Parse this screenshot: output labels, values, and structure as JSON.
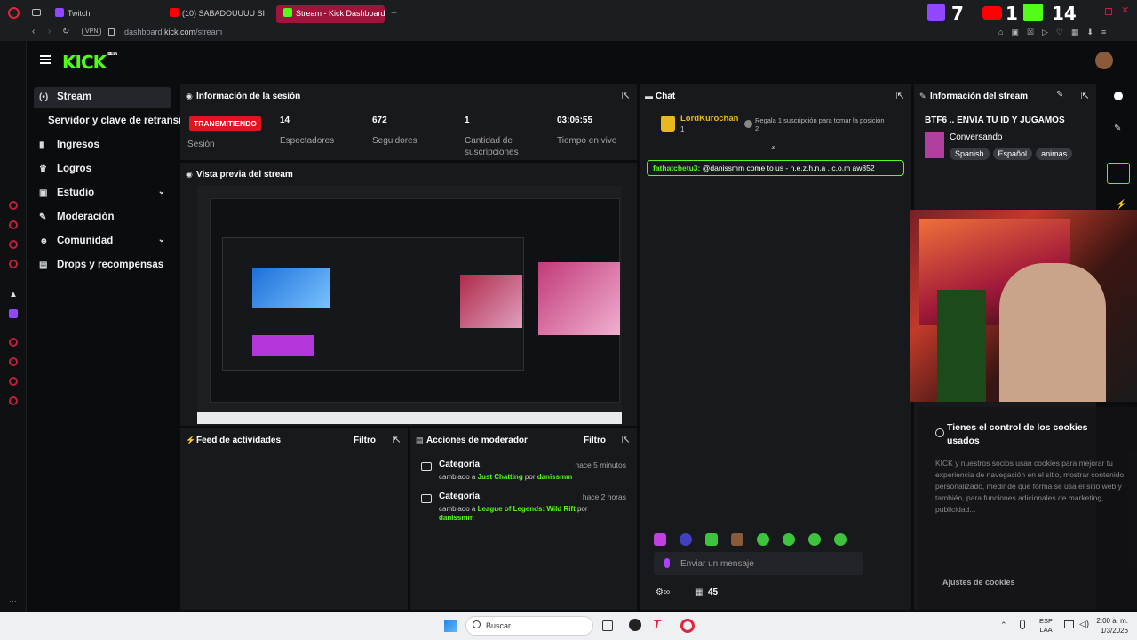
{
  "browser": {
    "tabs": [
      {
        "label": "Twitch",
        "color": "#9146ff"
      },
      {
        "label": "(10) SABADOUUUU SI",
        "color": "#ff0000"
      },
      {
        "label": "Stream - Kick Dashboard",
        "color": "#53fc18"
      }
    ],
    "vpn": "VPN",
    "url_host": "dashboard.",
    "url_domain": "kick.com",
    "url_path": "/stream",
    "overlay": {
      "twitch": "7",
      "youtube": "1",
      "kick": "14"
    }
  },
  "kick": {
    "logo": "KICK",
    "beta": "BETA",
    "nav": [
      {
        "label": "Stream",
        "icon": "radio-icon"
      },
      {
        "label": "Servidor y clave de retransmisión"
      },
      {
        "label": "Ingresos",
        "icon": "chart-icon"
      },
      {
        "label": "Logros",
        "icon": "trophy-icon"
      },
      {
        "label": "Estudio",
        "icon": "studio-icon"
      },
      {
        "label": "Moderación",
        "icon": "wrench-icon"
      },
      {
        "label": "Comunidad",
        "icon": "people-icon"
      },
      {
        "label": "Drops y recompensas",
        "icon": "gift-icon"
      }
    ]
  },
  "session": {
    "title": "Información de la sesión",
    "status": "TRANSMITIENDO",
    "status_label": "Sesión",
    "stats": [
      {
        "value": "14",
        "label": "Espectadores"
      },
      {
        "value": "672",
        "label": "Seguidores"
      },
      {
        "value": "1",
        "label": "Cantidad de suscripciones"
      },
      {
        "value": "03:06:55",
        "label": "Tiempo en vivo"
      }
    ]
  },
  "preview": {
    "title": "Vista previa del stream"
  },
  "activity": {
    "title": "Feed de actividades",
    "filter": "Filtro"
  },
  "mod_actions": {
    "title": "Acciones de moderador",
    "filter": "Filtro",
    "items": [
      {
        "title": "Categoría",
        "time": "hace 5 minutos",
        "prefix": "cambiado a ",
        "value": "Just Chatting",
        "by": " por ",
        "user": "danissmm"
      },
      {
        "title": "Categoría",
        "time": "hace 2 horas",
        "prefix": "cambiado a ",
        "value": "League of Legends: Wild Rift",
        "by": " por ",
        "user": "danissmm"
      }
    ]
  },
  "chat": {
    "title": "Chat",
    "pinned_user": "LordKurochan",
    "pinned_count": "1",
    "pinned_note": "Regala 1 suscripción para tomar la posición 2",
    "message_user": "fathatchetu3:",
    "message_text": " @danissmm come to us - n.e.z.h.n.a . c.o.m aw852",
    "input_placeholder": "Enviar un mensaje",
    "viewer_count": "45"
  },
  "stream_info": {
    "title": "Información del stream",
    "stream_title": "BTF6 .. ENVIA TU ID Y JUGAMOS",
    "category": "Conversando",
    "tags": [
      "Spanish",
      "Español",
      "animas"
    ]
  },
  "cookies": {
    "title": "Tienes el control de los cookies usados",
    "body": "KICK y nuestros socios usan cookies para mejorar tu experiencia de navegación en el sitio, mostrar contenido personalizado, medir de qué forma se usa el sitio web y también, para funciones adicionales de marketing, publicidad...",
    "settings": "Ajustes de cookies"
  },
  "taskbar": {
    "search": "Buscar",
    "lang": "ESP",
    "lang2": "LAA",
    "time": "2:00 a. m.",
    "date": "1/3/2026"
  }
}
